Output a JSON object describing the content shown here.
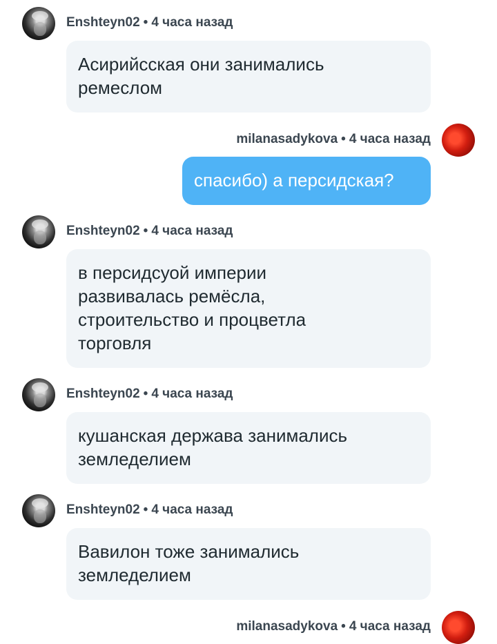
{
  "messages": [
    {
      "author": "Enshteyn02",
      "time": "4 часа назад",
      "text_lines": [
        "Асирийсская они занимались",
        "ремеслом"
      ]
    },
    {
      "author": "milanasadykova",
      "time": "4 часа назад",
      "text_lines": [
        "спасибо) а персидская?"
      ]
    },
    {
      "author": "Enshteyn02",
      "time": "4 часа назад",
      "text_lines": [
        "в персидсуой империи",
        "развивалась ремёсла,",
        "строительство и процветла",
        "торговля"
      ]
    },
    {
      "author": "Enshteyn02",
      "time": "4 часа назад",
      "text_lines": [
        "кушанская держава занимались",
        "земледелием"
      ]
    },
    {
      "author": "Enshteyn02",
      "time": "4 часа назад",
      "text_lines": [
        "Вавилон тоже занимались",
        "земледелием"
      ]
    },
    {
      "author": "milanasadykova",
      "time": "4 часа назад",
      "text_lines": []
    }
  ],
  "separator": "•"
}
